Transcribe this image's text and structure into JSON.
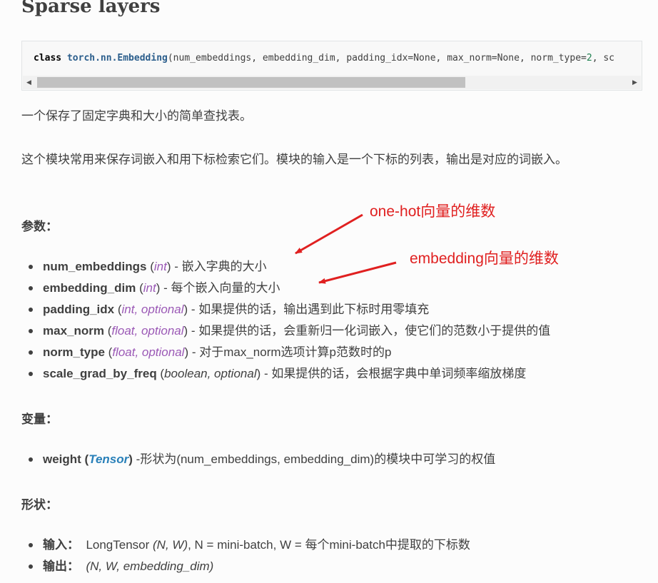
{
  "title": "Sparse layers",
  "code": {
    "keyword": "class",
    "classname": "torch.nn.Embedding",
    "params_a": "(num_embeddings, embedding_dim, padding_idx=None, max_norm=None, norm_type=",
    "num": "2",
    "params_b": ", sc"
  },
  "intro1": "一个保存了固定字典和大小的简单查找表。",
  "intro2": "这个模块常用来保存词嵌入和用下标检索它们。模块的输入是一个下标的列表，输出是对应的词嵌入。",
  "params_heading": "参数：",
  "params": [
    {
      "name": "num_embeddings",
      "open": " (",
      "type": "int",
      "opt": "",
      "close": ")",
      "desc": " - 嵌入字典的大小"
    },
    {
      "name": "embedding_dim",
      "open": " (",
      "type": "int",
      "opt": "",
      "close": ")",
      "desc": " - 每个嵌入向量的大小"
    },
    {
      "name": "padding_idx",
      "open": " (",
      "type": "int",
      "opt": ", optional",
      "close": ")",
      "desc": " - 如果提供的话，输出遇到此下标时用零填充"
    },
    {
      "name": "max_norm",
      "open": " (",
      "type": "float",
      "opt": ", optional",
      "close": ")",
      "desc": " - 如果提供的话，会重新归一化词嵌入，使它们的范数小于提供的值"
    },
    {
      "name": "norm_type",
      "open": " (",
      "type": "float",
      "opt": ", optional",
      "close": ")",
      "desc": " - 对于max_norm选项计算p范数时的p"
    },
    {
      "name": "scale_grad_by_freq",
      "open": " (",
      "type": "",
      "opt": "boolean, optional",
      "close": ")",
      "desc": " - 如果提供的话，会根据字典中单词频率缩放梯度"
    }
  ],
  "vars_heading": "变量：",
  "vars": {
    "name": "weight (",
    "type": "Tensor",
    "close": ")",
    "desc": " -形状为(num_embeddings, embedding_dim)的模块中可学习的权值"
  },
  "shape_heading": "形状：",
  "shapes": [
    {
      "label": "输入：",
      "value_a": "  LongTensor ",
      "value_it": "(N, W)",
      "value_b": ", N = mini-batch, W = 每个mini-batch中提取的下标数"
    },
    {
      "label": "输出：",
      "value_a": "  ",
      "value_it": "(N, W, embedding_dim)",
      "value_b": ""
    }
  ],
  "annotations": {
    "one_hot": "one-hot向量的维数",
    "embedding": "embedding向量的维数",
    "color": "#e02020"
  }
}
